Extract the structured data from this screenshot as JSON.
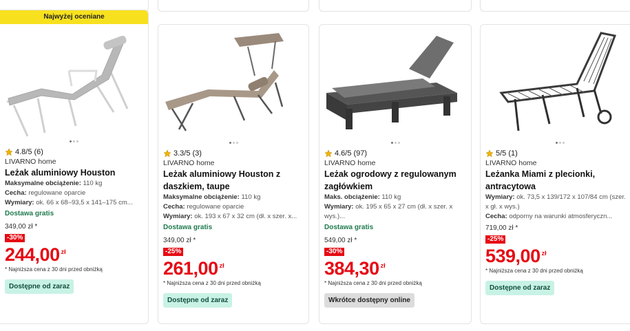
{
  "colors": {
    "accent_red": "#e60a14",
    "banner_yellow": "#f7e11f",
    "delivery_green": "#1f7a4d"
  },
  "products": [
    {
      "banner": "Najwyżej oceniane",
      "rating": "4.8/5 (6)",
      "brand": "LIVARNO home",
      "title": "Leżak aluminiowy Houston",
      "specs": [
        {
          "label": "Maksymalne obciążenie:",
          "value": " 110 kg"
        },
        {
          "label": "Cecha:",
          "value": " regulowane oparcie"
        },
        {
          "label": "Wymiary:",
          "value": " ok. 66 x 68–93,5 x 141–175 cm..."
        }
      ],
      "delivery": "Dostawa gratis",
      "old_price": "349,00 zł *",
      "discount": "-30%",
      "price": "244,00",
      "currency": "zł",
      "note": "* Najniższa cena z 30 dni przed obniżką",
      "availability": "Dostępne od zaraz"
    },
    {
      "rating": "3.3/5 (3)",
      "brand": "LIVARNO home",
      "title": "Leżak aluminiowy Houston z daszkiem, taupe",
      "specs": [
        {
          "label": "Maksymalne obciążenie:",
          "value": " 110 kg"
        },
        {
          "label": "Cecha:",
          "value": " regulowane oparcie"
        },
        {
          "label": "Wymiary:",
          "value": " ok. 193 x 67 x 32 cm (dł. x szer. x..."
        }
      ],
      "delivery": "Dostawa gratis",
      "old_price": "349,00 zł *",
      "discount": "-25%",
      "price": "261,00",
      "currency": "zł",
      "note": "* Najniższa cena z 30 dni przed obniżką",
      "availability": "Dostępne od zaraz"
    },
    {
      "rating": "4.6/5 (97)",
      "brand": "LIVARNO home",
      "title": "Leżak ogrodowy z regulowanym zagłówkiem",
      "specs": [
        {
          "label": "Maks. obciążenie:",
          "value": " 110 kg"
        },
        {
          "label": "Wymiary:",
          "value": " ok. 195 x 65 x 27 cm (dł. x szer. x wys.)..."
        }
      ],
      "delivery": "Dostawa gratis",
      "old_price": "549,00 zł *",
      "discount": "-30%",
      "price": "384,30",
      "currency": "zł",
      "note": "* Najniższa cena z 30 dni przed obniżką",
      "availability": "Wkrótce dostępny online"
    },
    {
      "rating": "5/5 (1)",
      "brand": "LIVARNO home",
      "title": "Leżanka Miami z plecionki, antracytowa",
      "specs": [
        {
          "label": "Wymiary:",
          "value": " ok. 73,5 x 139/172 x 107/84 cm (szer. x gł. x wys.)"
        },
        {
          "label": "Cecha:",
          "value": " odporny na warunki atmosferyczn..."
        }
      ],
      "delivery": "",
      "old_price": "719,00 zł *",
      "discount": "-25%",
      "price": "539,00",
      "currency": "zł",
      "note": "* Najniższa cena z 30 dni przed obniżką",
      "availability": "Dostępne od zaraz"
    }
  ]
}
